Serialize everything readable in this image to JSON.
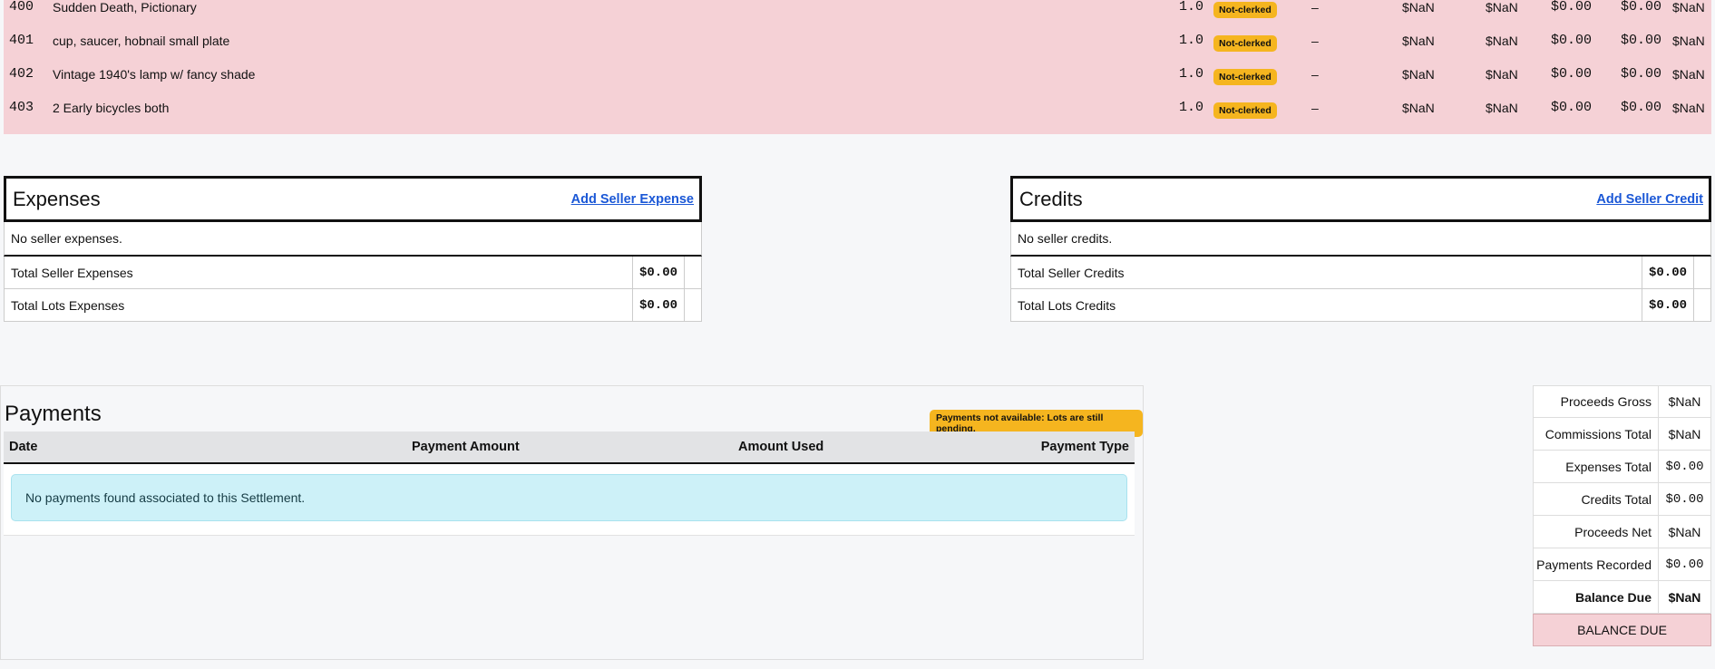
{
  "lots": [
    {
      "num": "400",
      "desc": "Sudden Death, Pictionary",
      "qty": "1.0",
      "status": "Not-clerked",
      "dash": "–",
      "c1": "$NaN",
      "c2": "$NaN",
      "c3": "$0.00",
      "c4": "$0.00",
      "c5": "$NaN"
    },
    {
      "num": "401",
      "desc": "cup, saucer, hobnail small plate",
      "qty": "1.0",
      "status": "Not-clerked",
      "dash": "–",
      "c1": "$NaN",
      "c2": "$NaN",
      "c3": "$0.00",
      "c4": "$0.00",
      "c5": "$NaN"
    },
    {
      "num": "402",
      "desc": "Vintage 1940's lamp w/ fancy shade",
      "qty": "1.0",
      "status": "Not-clerked",
      "dash": "–",
      "c1": "$NaN",
      "c2": "$NaN",
      "c3": "$0.00",
      "c4": "$0.00",
      "c5": "$NaN"
    },
    {
      "num": "403",
      "desc": "2 Early bicycles both",
      "qty": "1.0",
      "status": "Not-clerked",
      "dash": "–",
      "c1": "$NaN",
      "c2": "$NaN",
      "c3": "$0.00",
      "c4": "$0.00",
      "c5": "$NaN"
    }
  ],
  "expenses": {
    "title": "Expenses",
    "add_label": "Add Seller Expense",
    "empty": "No seller expenses.",
    "rows": [
      {
        "label": "Total Seller Expenses",
        "value": "$0.00"
      },
      {
        "label": "Total Lots Expenses",
        "value": "$0.00"
      }
    ]
  },
  "credits": {
    "title": "Credits",
    "add_label": "Add Seller Credit",
    "empty": "No seller credits.",
    "rows": [
      {
        "label": "Total Seller Credits",
        "value": "$0.00"
      },
      {
        "label": "Total Lots Credits",
        "value": "$0.00"
      }
    ]
  },
  "payments": {
    "title": "Payments",
    "badge": "Payments not available: Lots are still pending.",
    "columns": [
      "Date",
      "Payment Amount",
      "Amount Used",
      "Payment Type"
    ],
    "empty": "No payments found associated to this Settlement."
  },
  "summary": {
    "rows": [
      {
        "label": "Proceeds Gross",
        "value": "$NaN"
      },
      {
        "label": "Commissions Total",
        "value": "$NaN"
      },
      {
        "label": "Expenses Total",
        "value": "$0.00"
      },
      {
        "label": "Credits Total",
        "value": "$0.00"
      },
      {
        "label": "Proceeds Net",
        "value": "$NaN"
      },
      {
        "label": "Payments Recorded",
        "value": "$0.00"
      },
      {
        "label": "Balance Due",
        "value": "$NaN"
      }
    ],
    "balance_label": "BALANCE DUE"
  },
  "colors": {
    "row_pending": "#f5d1d6",
    "badge_warning": "#f5b51f",
    "link": "#1a57d6",
    "info_bg": "#cdf1f8"
  }
}
